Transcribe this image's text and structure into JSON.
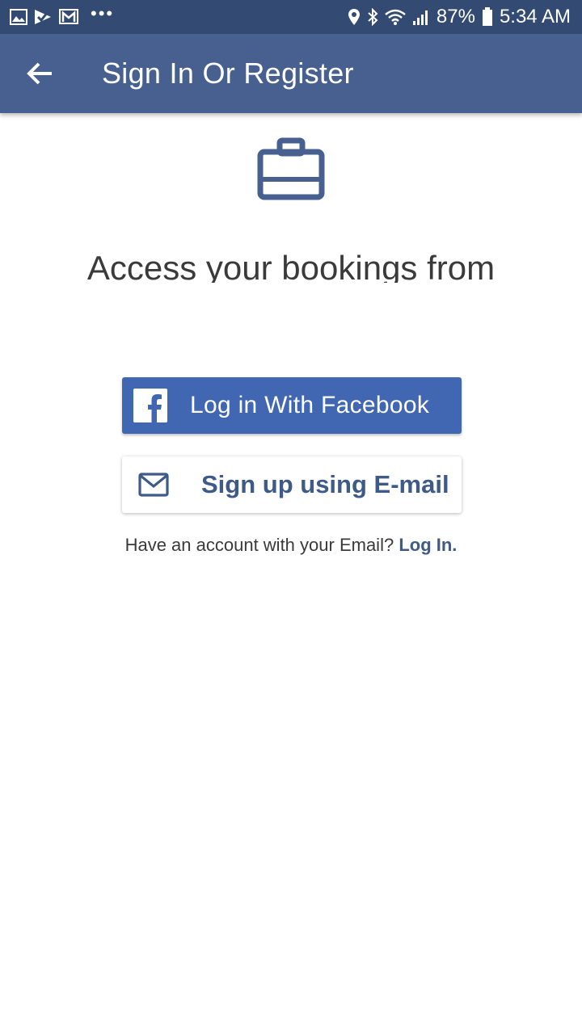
{
  "status_bar": {
    "battery": "87%",
    "time": "5:34 AM",
    "notification_icons": [
      "gallery-icon",
      "check-icon",
      "gmail-icon",
      "more-dots"
    ],
    "system_icons": [
      "location-icon",
      "bluetooth-icon",
      "wifi-icon",
      "signal-icon",
      "battery-icon"
    ],
    "dots": "•••"
  },
  "app_bar": {
    "title": "Sign In Or Register",
    "back_icon": "arrow-back-icon",
    "color": "#47608f"
  },
  "main": {
    "hero_icon": "briefcase-icon",
    "headline": "Access your bookings from",
    "facebook_button": {
      "label": "Log in With Facebook",
      "icon": "facebook-icon",
      "color": "#4267b2"
    },
    "email_button": {
      "label": "Sign up using E-mail",
      "icon": "mail-icon",
      "color": "#3d5a88"
    },
    "login_prompt": "Have an account with your Email?",
    "login_link": "Log In."
  }
}
